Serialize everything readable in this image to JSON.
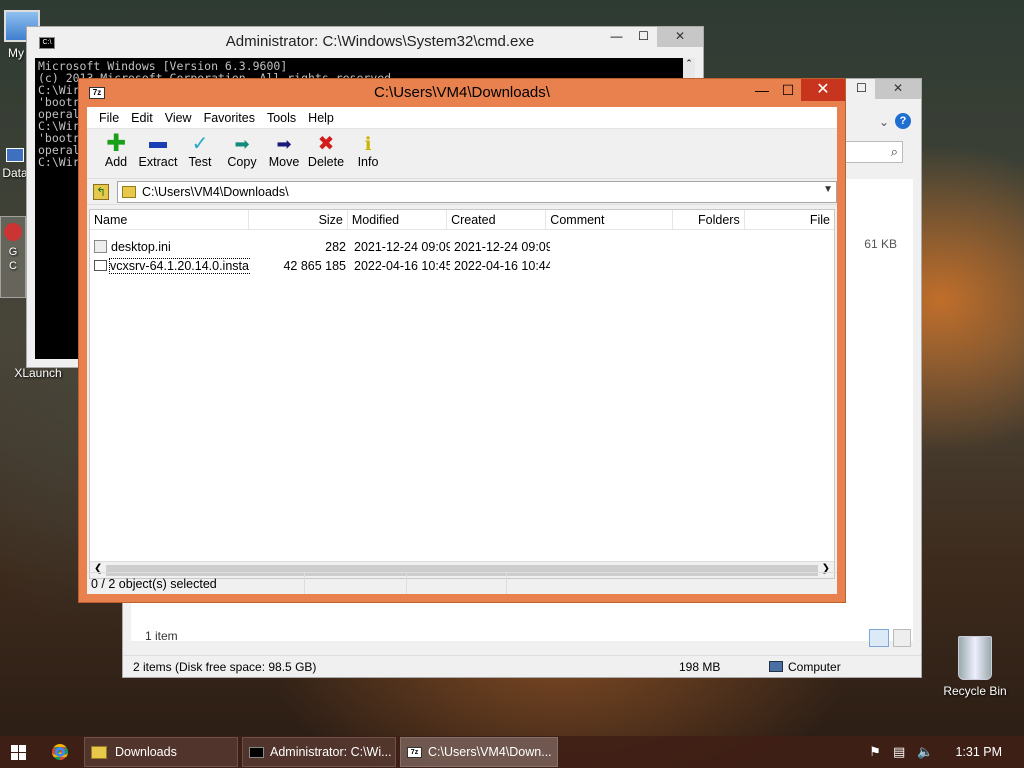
{
  "desktop": {
    "icons": {
      "my_computer": "My C",
      "data": "Data",
      "g": "G\nC",
      "xlaunch": "XLaunch",
      "recycle_bin": "Recycle Bin"
    }
  },
  "cmd": {
    "title": "Administrator: C:\\Windows\\System32\\cmd.exe",
    "lines": [
      "Microsoft Windows [Version 6.3.9600]",
      "(c) 2013 Microsoft Corporation. All rights reserved.",
      "",
      "C:\\Wir",
      "'bootr",
      "operal",
      "",
      "C:\\Wir",
      "'bootr",
      "operal",
      "",
      "C:\\Wir"
    ]
  },
  "explorer": {
    "right_size": "61 KB",
    "items_count": "1 item",
    "status_left": "2 items (Disk free space: 98.5 GB)",
    "status_size": "198 MB",
    "status_location": "Computer"
  },
  "sevenzip": {
    "title": "C:\\Users\\VM4\\Downloads\\",
    "menu": [
      "File",
      "Edit",
      "View",
      "Favorites",
      "Tools",
      "Help"
    ],
    "tools": [
      {
        "label": "Add",
        "icon": "plus-icon",
        "color": "#18a018"
      },
      {
        "label": "Extract",
        "icon": "minus-icon",
        "color": "#1a3fb5"
      },
      {
        "label": "Test",
        "icon": "check-icon",
        "color": "#25a8c8"
      },
      {
        "label": "Copy",
        "icon": "double-arrow-icon",
        "color": "#138a7a"
      },
      {
        "label": "Move",
        "icon": "arrow-right-icon",
        "color": "#1a1a7a"
      },
      {
        "label": "Delete",
        "icon": "x-icon",
        "color": "#d41b1b"
      },
      {
        "label": "Info",
        "icon": "info-icon",
        "color": "#c9b400"
      }
    ],
    "address": "C:\\Users\\VM4\\Downloads\\",
    "columns": [
      "Name",
      "Size",
      "Modified",
      "Created",
      "Comment",
      "Folders",
      "File"
    ],
    "files": [
      {
        "name": "desktop.ini",
        "size": "282",
        "modified": "2021-12-24 09:09",
        "created": "2021-12-24 09:09"
      },
      {
        "name": "vcxsrv-64.1.20.14.0.insta...",
        "size": "42 865 185",
        "modified": "2022-04-16 10:45",
        "created": "2022-04-16 10:44"
      }
    ],
    "status": "0 / 2 object(s) selected"
  },
  "taskbar": {
    "buttons": [
      {
        "label": "Downloads"
      },
      {
        "label": "Administrator: C:\\Wi..."
      },
      {
        "label": "C:\\Users\\VM4\\Down..."
      }
    ],
    "clock": "1:31 PM"
  }
}
